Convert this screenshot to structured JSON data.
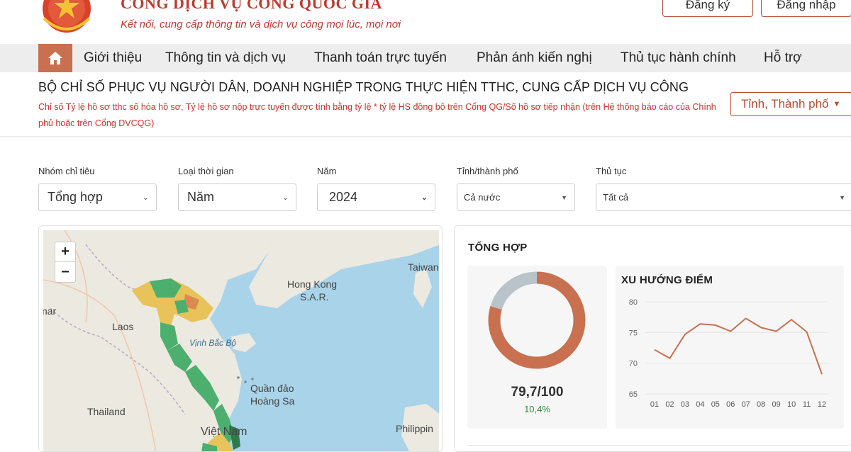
{
  "header": {
    "title": "CỔNG DỊCH VỤ CÔNG QUỐC GIA",
    "tagline": "Kết nối, cung cấp thông tin và dịch vụ công mọi lúc, mọi nơi",
    "register_label": "Đăng ký",
    "login_label": "Đăng nhập"
  },
  "nav": {
    "items": [
      "Giới thiệu",
      "Thông tin và dịch vụ",
      "Thanh toán trực tuyến",
      "Phản ánh kiến nghị",
      "Thủ tục hành chính",
      "Hỗ trợ"
    ]
  },
  "section": {
    "title": "BỘ CHỈ SỐ PHỤC VỤ NGƯỜI DÂN, DOANH NGHIỆP TRONG THỰC HIỆN TTHC, CUNG CẤP DỊCH VỤ CÔNG",
    "description": "Chỉ số Tỷ lệ hồ sơ tthc số hóa hồ sơ, Tỷ lệ hồ sơ nộp trực tuyến được tính bằng tỷ lệ * tỷ lệ HS đồng bộ trên Cổng QG/Số hồ sơ tiếp nhận (trên Hệ thống báo cáo của Chính phủ hoặc trên Cổng DVCQG)",
    "province_select": "Tỉnh, Thành phố"
  },
  "filters": [
    {
      "label": "Nhóm chỉ tiêu",
      "value": "Tổng hợp"
    },
    {
      "label": "Loại thời gian",
      "value": "Năm"
    },
    {
      "label": "Năm",
      "value": "2024"
    },
    {
      "label": "Tỉnh/thành phố",
      "value": "Cả nước"
    },
    {
      "label": "Thủ tục",
      "value": "Tất cả"
    }
  ],
  "map": {
    "zoom_in": "+",
    "zoom_out": "−",
    "labels": {
      "hongkong": "Hong Kong",
      "sar": "S.A.R.",
      "taiwan": "Taiwan",
      "myanmar": "mar",
      "laos": "Laos",
      "gulf": "Vịnh Bắc Bộ",
      "paracel1": "Quần đảo",
      "paracel2": "Hoàng Sa",
      "thailand": "Thailand",
      "vietnam": "Việt Nam",
      "philippines": "Philippin"
    },
    "colors": {
      "sea": "#a9d3e8",
      "land": "#ece9e1",
      "green": "#4caf6e",
      "yellow": "#e7c35a",
      "orange": "#d98a4f"
    }
  },
  "stats": {
    "title": "TỔNG HỢP",
    "score": "79,7/100",
    "change": "10,4%",
    "trend_title": "XU HƯỚNG ĐIỂM"
  },
  "chart_data": [
    {
      "type": "pie",
      "values": [
        79.7,
        20.3
      ],
      "colors": [
        "#c8704f",
        "#b9c4ca"
      ]
    },
    {
      "type": "line",
      "title": "XU HƯỚNG ĐIỂM",
      "categories": [
        "01",
        "02",
        "03",
        "04",
        "05",
        "06",
        "07",
        "08",
        "09",
        "10",
        "11",
        "12"
      ],
      "values": [
        72.2,
        70.8,
        74.7,
        76.4,
        76.2,
        75.2,
        77.3,
        75.8,
        75.2,
        77.1,
        75.1,
        68.2
      ],
      "ylim": [
        65,
        80
      ],
      "yticks": [
        65,
        70,
        75,
        80
      ],
      "color": "#c8704f"
    }
  ]
}
